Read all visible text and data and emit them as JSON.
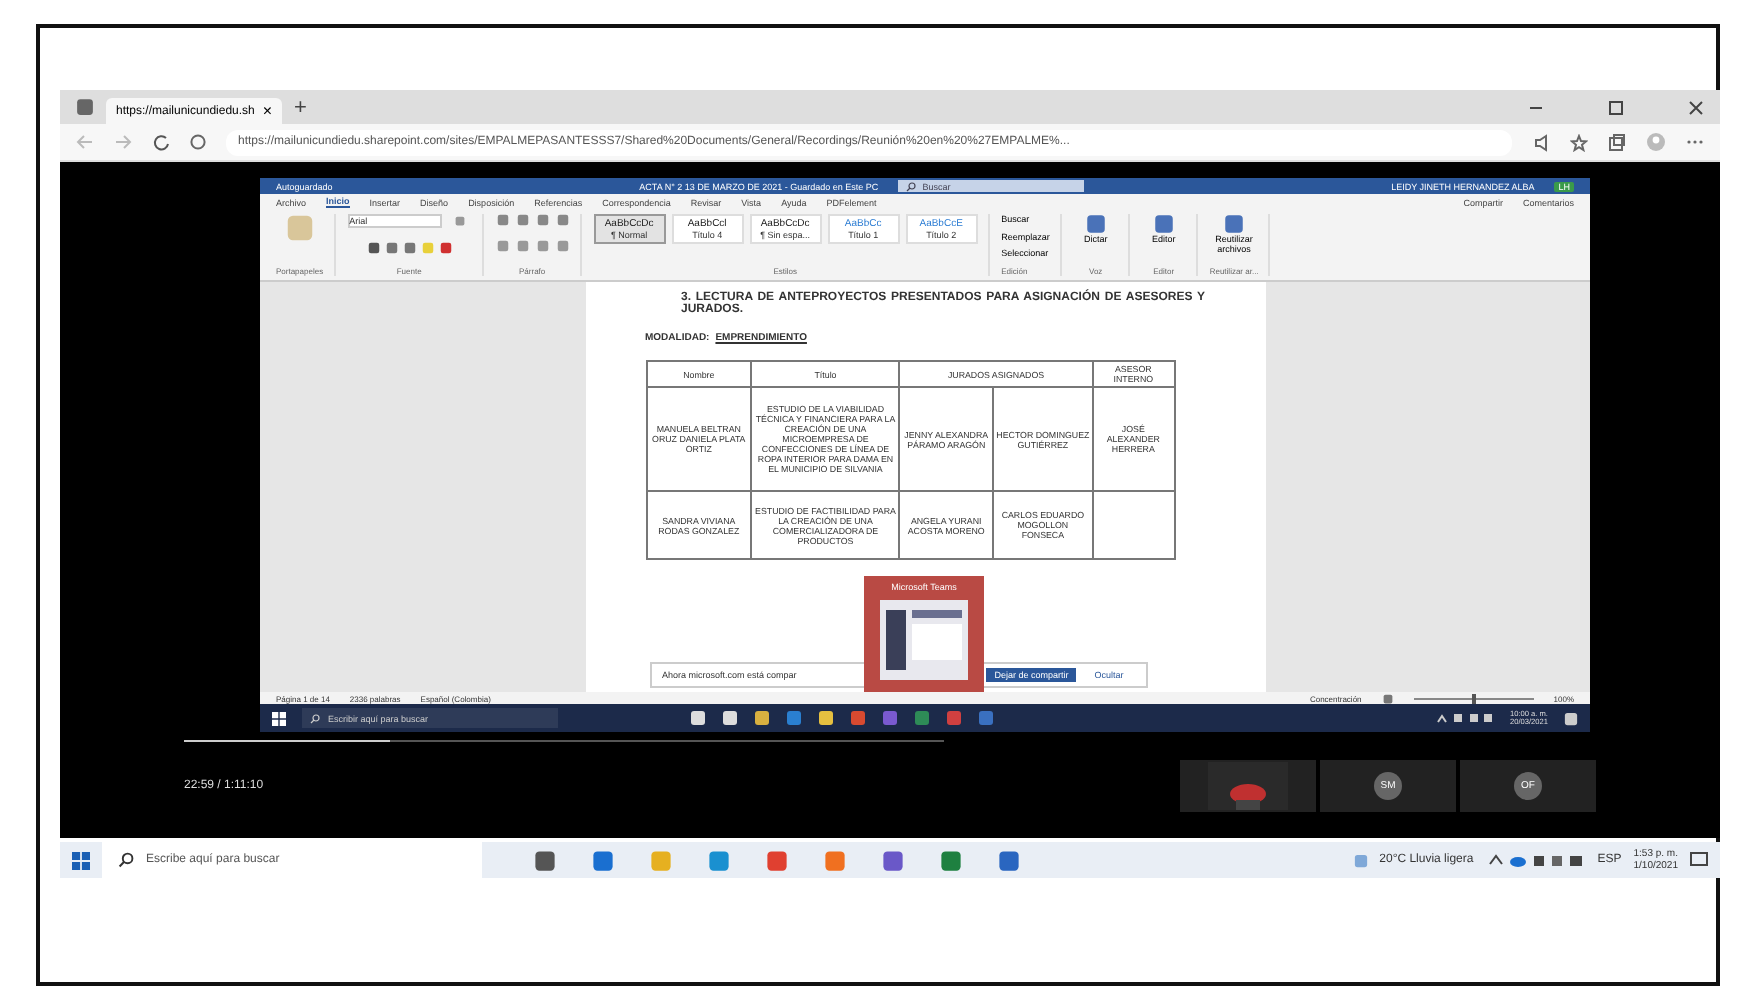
{
  "browser": {
    "tab_title": "https://mailunicundiedu.sh",
    "tab_close": "×",
    "new_tab": "+",
    "url": "https://mailunicundiedu.sharepoint.com/sites/EMPALMEPASANTESSS7/Shared%20Documents/General/Recordings/Reunión%20en%20%27EMPALME%..."
  },
  "word": {
    "autosave": "Autoguardado",
    "title": "ACTA N° 2 13 DE MARZO DE 2021 - Guardado en Este PC",
    "search": "Buscar",
    "user": "LEIDY JINETH HERNANDEZ ALBA",
    "user_initials": "LH",
    "menu": [
      {
        "label": "Archivo",
        "selected": false
      },
      {
        "label": "Inicio",
        "selected": true
      },
      {
        "label": "Insertar",
        "selected": false
      },
      {
        "label": "Diseño",
        "selected": false
      },
      {
        "label": "Disposición",
        "selected": false
      },
      {
        "label": "Referencias",
        "selected": false
      },
      {
        "label": "Correspondencia",
        "selected": false
      },
      {
        "label": "Revisar",
        "selected": false
      },
      {
        "label": "Vista",
        "selected": false
      },
      {
        "label": "Ayuda",
        "selected": false
      },
      {
        "label": "PDFelement",
        "selected": false
      }
    ],
    "share": "Compartir",
    "comments": "Comentarios",
    "font": "Arial",
    "styles": [
      {
        "sample": "AaBbCcDc",
        "name": "¶ Normal",
        "selected": true
      },
      {
        "sample": "AaBbCcl",
        "name": "Título 4",
        "selected": false
      },
      {
        "sample": "AaBbCcDc",
        "name": "¶ Sin espa...",
        "selected": false
      },
      {
        "sample": "AaBbCc",
        "name": "Título 1",
        "selected": false
      },
      {
        "sample": "AaBbCcE",
        "name": "Título 2",
        "selected": false
      }
    ],
    "commands": [
      "Buscar",
      "Reemplazar",
      "Seleccionar"
    ],
    "big_buttons": [
      "Dictar",
      "Editor",
      "Reutilizar archivos"
    ],
    "groups": [
      "Portapapeles",
      "Fuente",
      "Párrafo",
      "Estilos",
      "Edición",
      "Voz",
      "Editor",
      "Reutilizar ar..."
    ]
  },
  "document": {
    "heading": "3. LECTURA DE ANTEPROYECTOS PRESENTADOS PARA ASIGNACIÓN DE ASESORES Y JURADOS.",
    "modality_label": "MODALIDAD:",
    "modality": "EMPRENDIMIENTO",
    "columns": [
      "Nombre",
      "Título",
      "JURADOS ASIGNADOS",
      "ASESOR INTERNO"
    ],
    "rows": [
      {
        "name": "MANUELA BELTRAN ORUZ DANIELA PLATA ORTIZ",
        "title": "ESTUDIO DE LA VIABILIDAD TÉCNICA Y FINANCIERA PARA LA CREACIÓN DE UNA MICROEMPRESA DE CONFECCIONES DE LÍNEA DE ROPA INTERIOR PARA DAMA EN EL MUNICIPIO DE SILVANIA",
        "jury_1": "JENNY ALEXANDRA PÁRAMO ARAGÓN",
        "jury_2": "HECTOR DOMINGUEZ GUTIÉRREZ",
        "advisor": "JOSÉ ALEXANDER HERRERA"
      },
      {
        "name": "SANDRA VIVIANA RODAS GONZALEZ",
        "title": "ESTUDIO DE FACTIBILIDAD PARA LA CREACIÓN DE UNA COMERCIALIZADORA DE PRODUCTOS",
        "jury_1": "ANGELA YURANI ACOSTA MORENO",
        "jury_2": "CARLOS EDUARDO MOGOLLON FONSECA",
        "advisor": ""
      }
    ]
  },
  "teams_popup": {
    "title": "Microsoft Teams"
  },
  "share_notice": {
    "text": "Ahora microsoft.com está compar",
    "button": "Dejar de compartir",
    "hide": "Ocultar"
  },
  "status": {
    "page": "Página 1 de 14",
    "words": "2336 palabras",
    "language": "Español (Colombia)",
    "focus": "Concentración",
    "zoom": "100%",
    "zoom_slider": {
      "level": 0.5
    }
  },
  "inner_taskbar": {
    "search": "Escribir aquí para buscar",
    "time": "10:00 a. m.",
    "date": "20/03/2021"
  },
  "player": {
    "time": "22:59 / 1:11:10",
    "level": 0.27,
    "participants": [
      {
        "initials": "SM"
      },
      {
        "initials": "OF"
      }
    ]
  },
  "taskbar": {
    "search": "Escribe aquí para buscar",
    "weather": "20°C  Lluvia ligera",
    "lang": "ESP",
    "time": "1:53 p. m.",
    "date": "1/10/2021"
  }
}
